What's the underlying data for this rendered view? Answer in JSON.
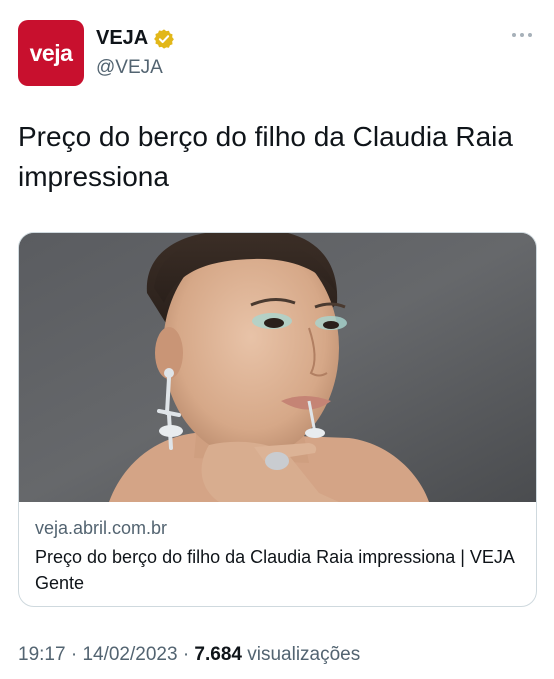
{
  "author": {
    "avatar_text": "veja",
    "display_name": "VEJA",
    "handle": "@VEJA",
    "verified_badge": "gold-verified-icon",
    "brand_color": "#c8102e",
    "badge_color": "#e2b719"
  },
  "tweet": {
    "text": "Preço do berço do filho da Claudia Raia impressiona"
  },
  "link_card": {
    "image": "portrait-photo",
    "domain": "veja.abril.com.br",
    "title": "Preço do berço do filho da Claudia Raia impressiona | VEJA Gente"
  },
  "footer": {
    "time": "19:17",
    "separator": "·",
    "date": "14/02/2023",
    "views_count": "7.684",
    "views_label": "visualizações"
  }
}
